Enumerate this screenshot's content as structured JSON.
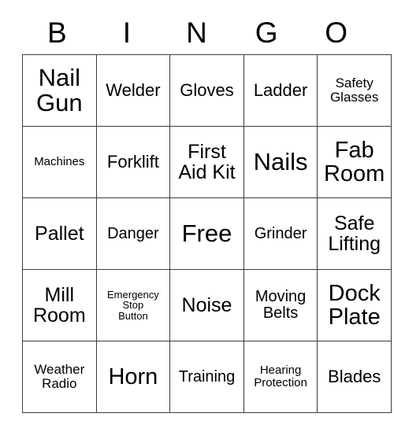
{
  "card": {
    "headers": [
      "B",
      "I",
      "N",
      "G",
      "O"
    ],
    "rows": [
      [
        {
          "text": "Nail\nGun",
          "size": "fs-xxl"
        },
        {
          "text": "Welder",
          "size": "fs-m"
        },
        {
          "text": "Gloves",
          "size": "fs-m"
        },
        {
          "text": "Ladder",
          "size": "fs-m"
        },
        {
          "text": "Safety\nGlasses",
          "size": "fs-xs"
        }
      ],
      [
        {
          "text": "Machines",
          "size": "fs-xxs"
        },
        {
          "text": "Forklift",
          "size": "fs-m"
        },
        {
          "text": "First\nAid Kit",
          "size": "fs-l"
        },
        {
          "text": "Nails",
          "size": "fs-xxl"
        },
        {
          "text": "Fab\nRoom",
          "size": "fs-xl"
        }
      ],
      [
        {
          "text": "Pallet",
          "size": "fs-l"
        },
        {
          "text": "Danger",
          "size": "fs-s"
        },
        {
          "text": "Free",
          "size": "fs-xxl"
        },
        {
          "text": "Grinder",
          "size": "fs-s"
        },
        {
          "text": "Safe\nLifting",
          "size": "fs-l"
        }
      ],
      [
        {
          "text": "Mill\nRoom",
          "size": "fs-l"
        },
        {
          "text": "Emergency\nStop\nButton",
          "size": "fs-tiny"
        },
        {
          "text": "Noise",
          "size": "fs-l"
        },
        {
          "text": "Moving\nBelts",
          "size": "fs-s"
        },
        {
          "text": "Dock\nPlate",
          "size": "fs-xl"
        }
      ],
      [
        {
          "text": "Weather\nRadio",
          "size": "fs-xs"
        },
        {
          "text": "Horn",
          "size": "fs-xl"
        },
        {
          "text": "Training",
          "size": "fs-s"
        },
        {
          "text": "Hearing\nProtection",
          "size": "fs-xxs"
        },
        {
          "text": "Blades",
          "size": "fs-m"
        }
      ]
    ],
    "free_space_label": "Free",
    "colors": {
      "background": "#ffffff",
      "text": "#000000",
      "grid_line": "#3c3c3c",
      "grid_outer": "#000000"
    }
  }
}
